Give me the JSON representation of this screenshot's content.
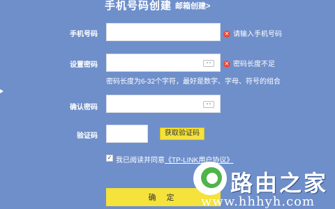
{
  "header": {
    "title": "手机号码创建",
    "email_link": "邮箱创建>"
  },
  "form": {
    "phone": {
      "label": "手机号码",
      "value": "",
      "error": "请输入手机号码"
    },
    "password": {
      "label": "设置密码",
      "value": "",
      "error": "密码长度不足",
      "hint": "密码长度为6-32个字符，最好是数字、字母、符号的组合"
    },
    "confirm_password": {
      "label": "确认密码",
      "value": ""
    },
    "captcha": {
      "label": "验证码",
      "value": "",
      "button": "获取验证码"
    },
    "agreement": {
      "checked": true,
      "text": "我已阅读并同意",
      "link": "《TP-LINK用户协议》"
    },
    "submit": "确 定"
  },
  "watermark": {
    "brand": "路由之家",
    "url": "www.hhhyh.com"
  },
  "colors": {
    "background": "#6f8fcb",
    "accent": "#f5e23a",
    "error": "#e74a3b"
  }
}
